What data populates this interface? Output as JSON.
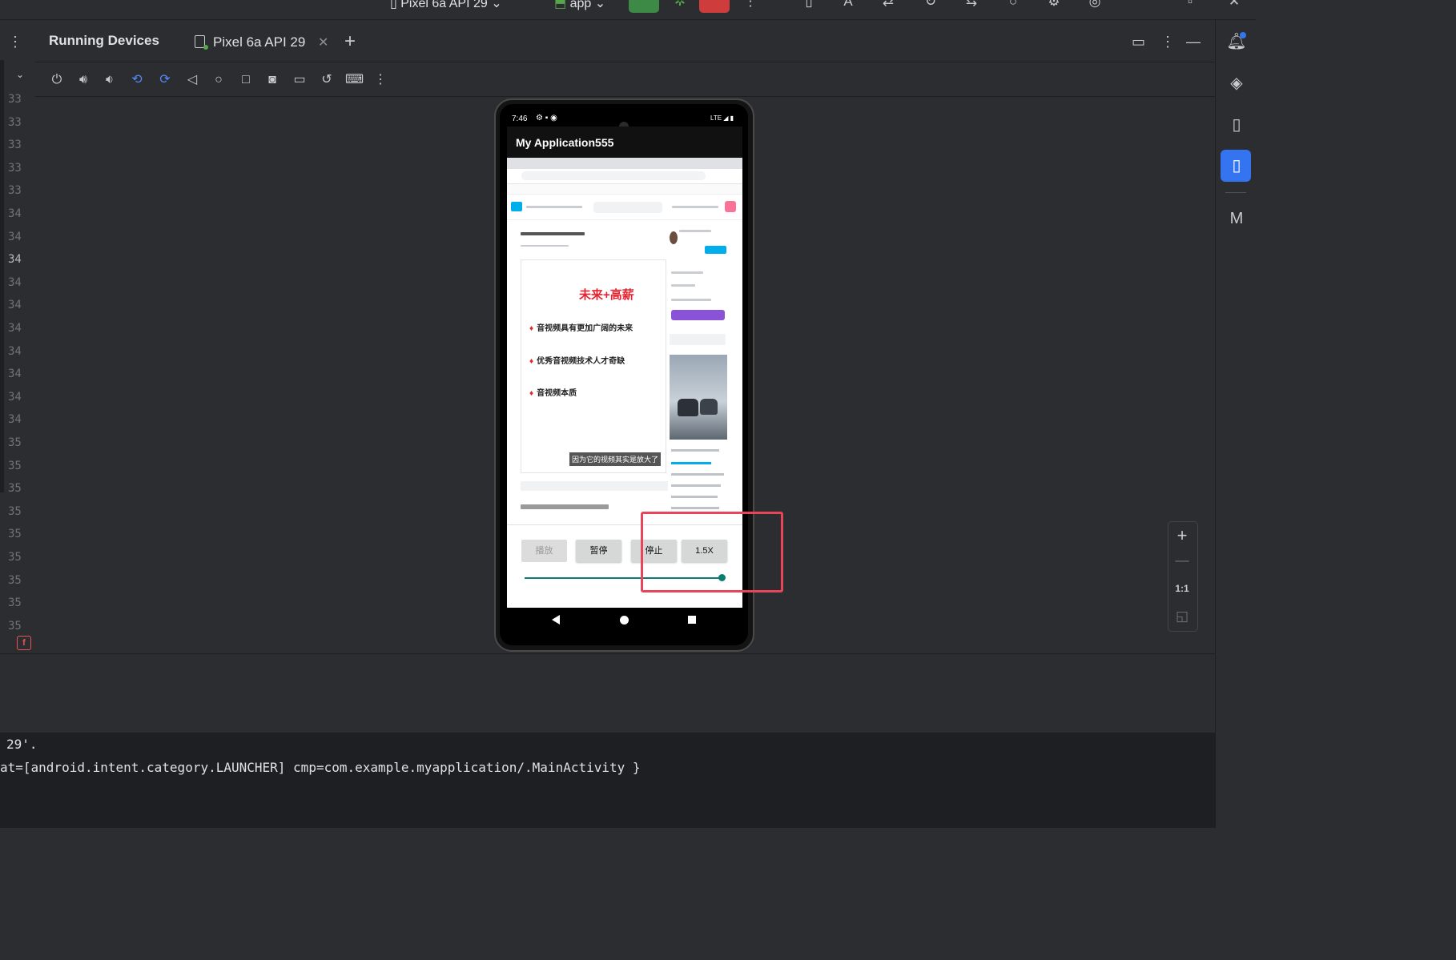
{
  "top_bar": {
    "device_selector": "Pixel 6a API 29",
    "run_config": "app"
  },
  "panel": {
    "title": "Running Devices",
    "device_tab": "Pixel 6a API 29"
  },
  "editor_gutter": {
    "line_numbers": [
      "33",
      "33",
      "33",
      "33",
      "33",
      "34",
      "34",
      "34",
      "34",
      "34",
      "34",
      "34",
      "34",
      "34",
      "34",
      "35",
      "35",
      "35",
      "35",
      "35",
      "35",
      "35",
      "35",
      "35"
    ]
  },
  "toolbar": {
    "icons": [
      "power-icon",
      "volume-up-icon",
      "volume-down-icon",
      "rotate-left-icon",
      "rotate-right-icon",
      "back-icon",
      "home-icon",
      "overview-icon",
      "screenshot-icon",
      "screen-record-icon",
      "reset-icon",
      "keyboard-icon",
      "more-icon"
    ]
  },
  "zoom": {
    "actual_size_label": "1:1"
  },
  "emulator": {
    "status_time": "7:46",
    "network": "LTE",
    "app_title": "My Application555",
    "video": {
      "title": "未来+高薪",
      "bullets": [
        "音视频具有更加广阔的未来",
        "优秀音视频技术人才奇缺",
        "音视频本质"
      ],
      "subtitle": "因为它的视频其实是放大了"
    },
    "controls": {
      "play": "播放",
      "pause": "暂停",
      "stop": "停止",
      "speed": "1.5X"
    },
    "progress_fraction": 0.99
  },
  "console": {
    "lines": [
      "29'.",
      "at=[android.intent.category.LAUNCHER] cmp=com.example.myapplication/.MainActivity }"
    ]
  },
  "colors": {
    "ide_bg": "#2b2d30",
    "console_bg": "#1e1f22",
    "accent": "#3574f0",
    "run_green": "#3d8a46",
    "stop_red": "#cf3c3c",
    "highlight": "#e8455a",
    "seekbar": "#0a7c71"
  }
}
